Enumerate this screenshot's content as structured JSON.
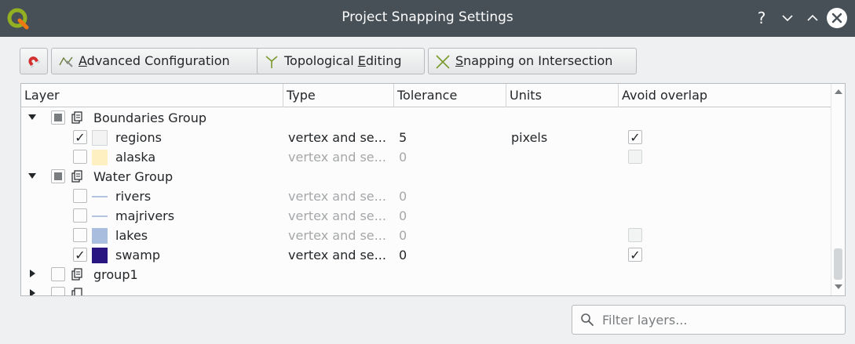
{
  "window": {
    "title": "Project Snapping Settings"
  },
  "titlebar_buttons": {
    "help": "?",
    "minimize": "⌄",
    "maximize": "^",
    "close": "×"
  },
  "toolbar": {
    "advanced_configuration": {
      "label_pre": "",
      "mnemonic": "A",
      "label_post": "dvanced Configuration"
    },
    "topological_editing": {
      "label_pre": "Topological ",
      "mnemonic": "E",
      "label_post": "diting"
    },
    "snapping_on_intersection": {
      "label_pre": "",
      "mnemonic": "S",
      "label_post": "napping on Intersection"
    }
  },
  "tree": {
    "columns": [
      "Layer",
      "Type",
      "Tolerance",
      "Units",
      "Avoid overlap"
    ],
    "rows": [
      {
        "kind": "group",
        "name": "Boundaries Group",
        "expanded": true,
        "checked": "partial"
      },
      {
        "kind": "layer",
        "name": "regions",
        "checked": true,
        "type": "vertex and se...",
        "tolerance": "5",
        "units": "pixels",
        "avoid_overlap": true,
        "symbol": "polygon",
        "symbol_color": "#f3f3f3"
      },
      {
        "kind": "layer",
        "name": "alaska",
        "checked": false,
        "type": "vertex and se...",
        "tolerance": "0",
        "units": "",
        "avoid_overlap": false,
        "symbol": "polygon",
        "symbol_color": "#fff0c2"
      },
      {
        "kind": "group",
        "name": "Water Group",
        "expanded": true,
        "checked": "partial"
      },
      {
        "kind": "layer",
        "name": "rivers",
        "checked": false,
        "type": "vertex and se...",
        "tolerance": "0",
        "units": "",
        "symbol": "line",
        "symbol_color": "#9cb2d6"
      },
      {
        "kind": "layer",
        "name": "majrivers",
        "checked": false,
        "type": "vertex and se...",
        "tolerance": "0",
        "units": "",
        "symbol": "line",
        "symbol_color": "#9cb2d6"
      },
      {
        "kind": "layer",
        "name": "lakes",
        "checked": false,
        "type": "vertex and se...",
        "tolerance": "0",
        "units": "",
        "avoid_overlap": false,
        "symbol": "polygon",
        "symbol_color": "#a9bedf"
      },
      {
        "kind": "layer",
        "name": "swamp",
        "checked": true,
        "type": "vertex and se...",
        "tolerance": "0",
        "units": "",
        "avoid_overlap": true,
        "symbol": "polygon",
        "symbol_color": "#2a1680"
      },
      {
        "kind": "group",
        "name": "group1",
        "expanded": false,
        "checked": false
      }
    ]
  },
  "filter": {
    "placeholder": "Filter layers...",
    "value": ""
  },
  "colors": {
    "titlebar": "#475057",
    "background": "#eff0f1",
    "panel": "#fcfcfc",
    "border": "#b8bbbe"
  }
}
